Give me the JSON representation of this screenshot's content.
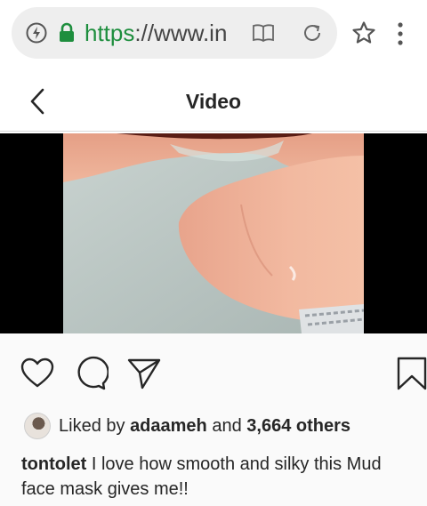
{
  "browser": {
    "url_scheme": "https",
    "url_rest": "://www.in",
    "accent_color": "#1e8e3e"
  },
  "header": {
    "title": "Video"
  },
  "post": {
    "liked_prefix": "Liked by ",
    "liked_user": "adaameh",
    "liked_middle": " and ",
    "liked_count": "3,664 others",
    "caption_user": "tontolet",
    "caption_text": " I love how smooth and silky this Mud face mask gives me!!"
  },
  "icons": [
    "bolt-icon",
    "lock-icon",
    "reader-mode-icon",
    "refresh-icon",
    "star-icon",
    "more-menu-icon",
    "back-arrow-icon",
    "heart-icon",
    "comment-icon",
    "share-icon",
    "bookmark-icon"
  ]
}
